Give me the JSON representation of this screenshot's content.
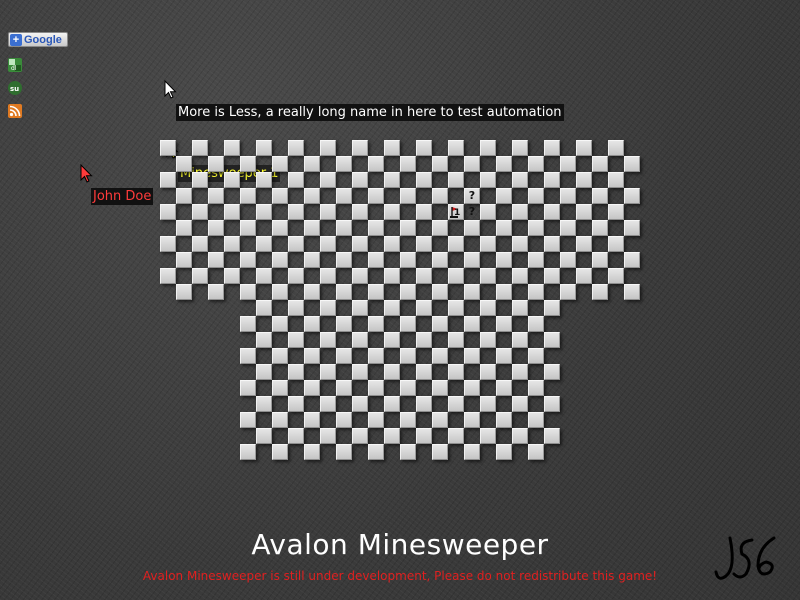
{
  "sharebar": {
    "google_label": "Google",
    "icons": [
      "delicious-icon",
      "stumbleupon-icon",
      "rss-icon"
    ]
  },
  "players": [
    {
      "name": "More is Less, a really long name in here to test automation",
      "color": "#ffffff"
    },
    {
      "name": "Minesweeper 1",
      "color": "#ffff33"
    },
    {
      "name": "John Doe",
      "color": "#ff3b3b"
    }
  ],
  "board": {
    "cols": 30,
    "rows": 20,
    "cells_hidden_pattern": "checkerboard-with-step-bottom",
    "markers": [
      {
        "col": 19,
        "row": 3,
        "text": "?"
      },
      {
        "col": 19,
        "row": 4,
        "text": "?"
      },
      {
        "col": 18,
        "row": 4,
        "text": "1",
        "flag": true
      }
    ]
  },
  "footer": {
    "title": "Avalon Minesweeper",
    "notice": "Avalon Minesweeper is still under development, Please do not redistribute this game!"
  },
  "colors": {
    "accent_red": "#e02020",
    "tile": "#d6d6d6",
    "background": "#3d3d3d"
  }
}
